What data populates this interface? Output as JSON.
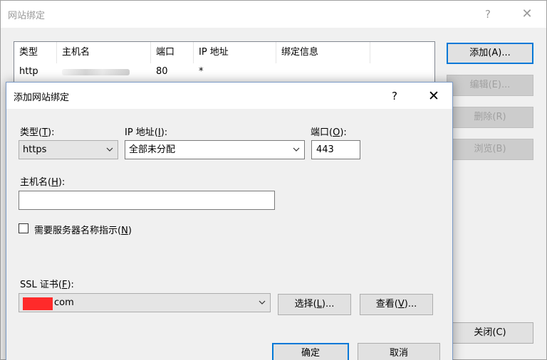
{
  "parent": {
    "title": "网站绑定",
    "help_glyph": "?",
    "close_glyph": "✕",
    "columns": [
      "类型",
      "主机名",
      "端口",
      "IP 地址",
      "绑定信息"
    ],
    "rows": [
      {
        "type": "http",
        "port": "80",
        "ip": "*"
      }
    ],
    "buttons": {
      "add": "添加(A)...",
      "edit": "编辑(E)...",
      "remove": "删除(R)",
      "browse": "浏览(B)",
      "close": "关闭(C)"
    }
  },
  "dialog": {
    "title": "添加网站绑定",
    "help_glyph": "?",
    "close_glyph": "✕",
    "type": {
      "label_pre": "类型(",
      "key": "T",
      "label_post": "):",
      "value": "https"
    },
    "ip": {
      "label_pre": "IP 地址(",
      "key": "I",
      "label_post": "):",
      "value": "全部未分配"
    },
    "port": {
      "label_pre": "端口(",
      "key": "O",
      "label_post": "):",
      "value": "443"
    },
    "hostname": {
      "label_pre": "主机名(",
      "key": "H",
      "label_post": "):",
      "value": ""
    },
    "sni": {
      "label_pre": "需要服务器名称指示(",
      "key": "N",
      "label_post": ")",
      "checked": false
    },
    "ssl": {
      "label_pre": "SSL 证书(",
      "key": "F",
      "label_post": "):",
      "value": "com"
    },
    "buttons": {
      "select_pre": "选择(",
      "select_key": "L",
      "select_post": ")...",
      "view_pre": "查看(",
      "view_key": "V",
      "view_post": ")...",
      "ok": "确定",
      "cancel": "取消"
    }
  },
  "colors": {
    "accent": "#0078d7",
    "redaction": "#ff2a2a"
  }
}
